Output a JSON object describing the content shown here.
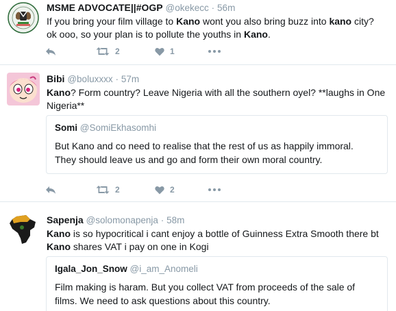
{
  "tweets": [
    {
      "author": "MSME ADVOCATE||#OGP",
      "handle": "@okekecc",
      "sep": "·",
      "time": "56m",
      "line1_a": "If you bring your film village to ",
      "line1_k1": "Kano",
      "line1_b": " wont you also bring buzz into ",
      "line1_k2": "kano",
      "line1_c": " city?",
      "line2_a": "ok ooo, so your plan is to pollute the youths in ",
      "line2_k": "Kano",
      "line2_b": ".",
      "retweets": "2",
      "likes": "1"
    },
    {
      "author": "Bibi",
      "handle": "@boluxxxx",
      "sep": "·",
      "time": "57m",
      "line1_k": "Kano",
      "line1_b": "? Form country? Leave Nigeria with all the southern oyel? **laughs in One",
      "line2": "Nigeria**",
      "quote": {
        "author": "Somi",
        "handle": "@SomiEkhasomhi",
        "line1": "But Kano and co need to realise that the rest of us as happily immoral.",
        "line2": "They should leave us and go and form their own moral country."
      },
      "retweets": "2",
      "likes": "2"
    },
    {
      "author": "Sapenja",
      "handle": "@solomonapenja",
      "sep": "·",
      "time": "58m",
      "line1_k": "Kano",
      "line1_b": " is so hypocritical i cant enjoy a bottle of Guinness Extra Smooth there bt",
      "line2_k": "Kano",
      "line2_b": " shares VAT i pay on one in Kogi",
      "quote": {
        "author": "Igala_Jon_Snow",
        "handle": "@i_am_Anomeli",
        "line1": "Film making is haram. But you collect VAT from proceeds of the sale of",
        "line2": "films. We need to ask questions about this country."
      }
    }
  ],
  "colors": {
    "text": "#14171a",
    "muted": "#8899a6",
    "border": "#e1e8ed"
  },
  "icons": {
    "reply": "reply-icon",
    "retweet": "retweet-icon",
    "like": "heart-icon",
    "more": "more-icon"
  }
}
